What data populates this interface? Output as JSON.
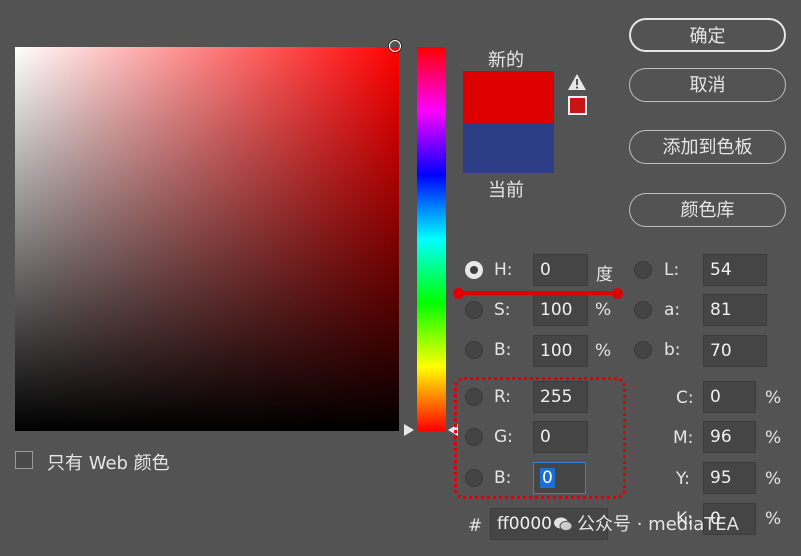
{
  "swatches": {
    "new_label": "新的",
    "current_label": "当前",
    "new_color": "#dc0000",
    "current_color": "#2d3e86"
  },
  "buttons": {
    "ok": "确定",
    "cancel": "取消",
    "add_to_swatches": "添加到色板",
    "color_libraries": "颜色库"
  },
  "web_only_label": "只有 Web 颜色",
  "hsb": {
    "h": {
      "label": "H:",
      "value": "0",
      "unit": "度"
    },
    "s": {
      "label": "S:",
      "value": "100",
      "unit": "%"
    },
    "b": {
      "label": "B:",
      "value": "100",
      "unit": "%"
    }
  },
  "lab": {
    "l": {
      "label": "L:",
      "value": "54"
    },
    "a": {
      "label": "a:",
      "value": "81"
    },
    "b": {
      "label": "b:",
      "value": "70"
    }
  },
  "rgb": {
    "r": {
      "label": "R:",
      "value": "255"
    },
    "g": {
      "label": "G:",
      "value": "0"
    },
    "b": {
      "label": "B:",
      "value": "0"
    }
  },
  "cmyk": {
    "c": {
      "label": "C:",
      "value": "0",
      "unit": "%"
    },
    "m": {
      "label": "M:",
      "value": "96",
      "unit": "%"
    },
    "y": {
      "label": "Y:",
      "value": "95",
      "unit": "%"
    },
    "k": {
      "label": "K:",
      "value": "0",
      "unit": "%"
    }
  },
  "hex": {
    "label": "#",
    "value": "ff0000"
  },
  "watermark": "公众号 · mediaTEA",
  "colors": {
    "accent_red": "#e00000",
    "selection_blue": "#1a6ed8"
  }
}
